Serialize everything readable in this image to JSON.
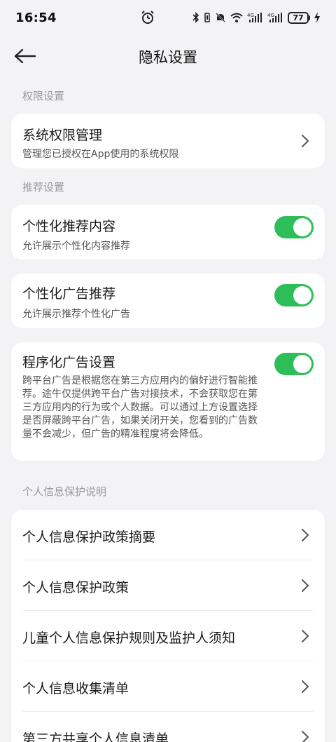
{
  "status_bar": {
    "time": "16:54",
    "battery": "77",
    "icons": [
      "alarm-icon",
      "bluetooth-icon",
      "vibrate-icon",
      "mute-icon",
      "wifi-icon",
      "signal-4g-icon",
      "signal-4g-icon",
      "battery-icon",
      "charging-icon"
    ]
  },
  "header": {
    "title": "隐私设置",
    "back_icon": "back-arrow-icon"
  },
  "sections": {
    "permissions": {
      "title": "权限设置",
      "item": {
        "title": "系统权限管理",
        "subtitle": "管理您已授权在App使用的系统权限"
      }
    },
    "recommend": {
      "title": "推荐设置",
      "personalized_content": {
        "title": "个性化推荐内容",
        "subtitle": "允许展示个性化内容推荐",
        "enabled": true
      },
      "personalized_ads": {
        "title": "个性化广告推荐",
        "subtitle": "允许展示推荐个性化广告",
        "enabled": true
      },
      "programmatic_ads": {
        "title": "程序化广告设置",
        "description": "跨平台广告是根据您在第三方应用内的偏好进行智能推荐。途牛仅提供跨平台广告对接技术，不会获取您在第三方应用内的行为或个人数据。可以通过上方设置选择是否屏蔽跨平台广告，如果关闭开关，您看到的广告数量不会减少，但广告的精准程度将会降低。",
        "enabled": true
      }
    },
    "privacy_info": {
      "title": "个人信息保护说明",
      "items": [
        "个人信息保护政策摘要",
        "个人信息保护政策",
        "儿童个人信息保护规则及监护人须知",
        "个人信息收集清单",
        "第三方共享个人信息清单"
      ]
    }
  },
  "colors": {
    "background": "#f3f3f5",
    "toggle_on": "#2dbe5a",
    "section_title": "#9a9a9a"
  }
}
